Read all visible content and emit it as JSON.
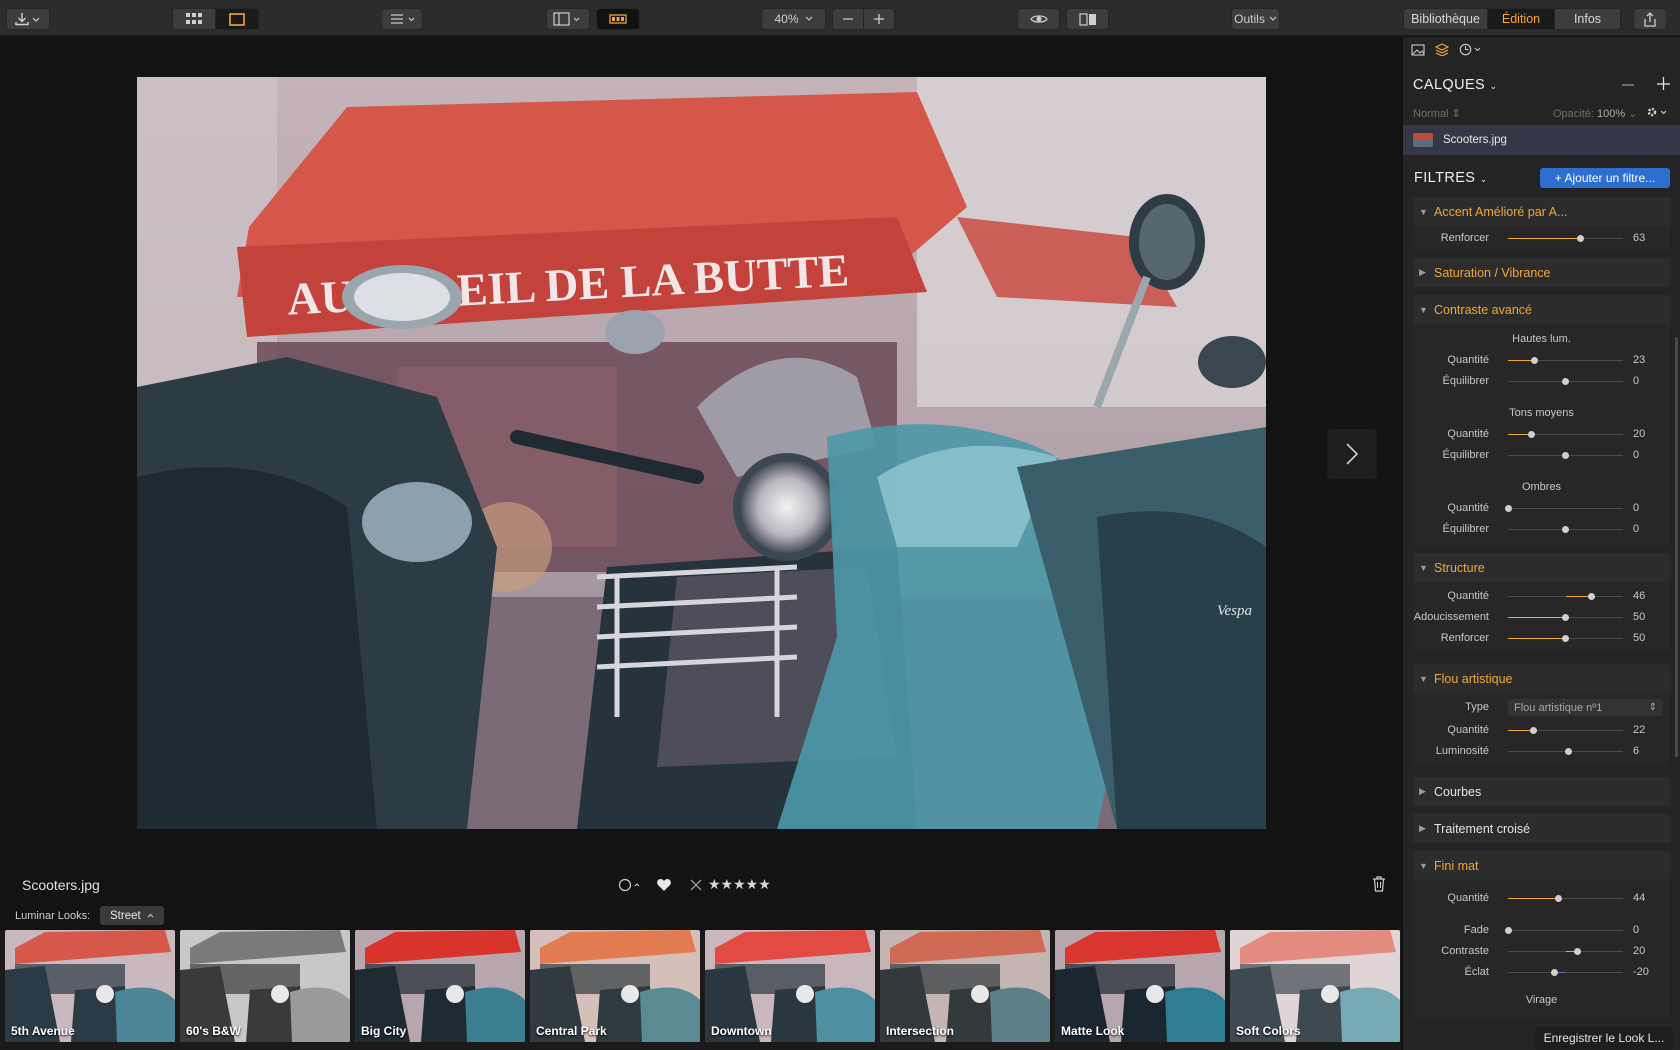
{
  "toolbar": {
    "zoom": "40%",
    "tools_label": "Outils",
    "tabs": [
      "Bibliothèque",
      "Édition",
      "Infos"
    ],
    "active_tab": "Édition",
    "accent": "#f0a83a"
  },
  "image": {
    "filename": "Scooters.jpg",
    "awning_text": "AU SOLEIL DE LA BUTTE",
    "scooter_badge": "Vespa"
  },
  "rating": {
    "stars": "★★★★★"
  },
  "looks": {
    "label": "Luminar Looks:",
    "selected": "Street",
    "items": [
      "5th Avenue",
      "60's B&W",
      "Big City",
      "Central Park",
      "Downtown",
      "Intersection",
      "Matte Look",
      "Soft Colors"
    ]
  },
  "panel": {
    "layers_title": "CALQUES",
    "blend_mode": "Normal",
    "opacity_label": "Opacité:",
    "opacity_value": "100%",
    "layer_name": "Scooters.jpg",
    "filters_title": "FILTRES",
    "add_filter": "+ Ajouter un filtre...",
    "save_look": "Enregistrer le Look L...",
    "sections": {
      "accent": {
        "title": "Accent Amélioré par A...",
        "renforcer_label": "Renforcer",
        "renforcer": 63
      },
      "saturation": {
        "title": "Saturation / Vibrance"
      },
      "contraste": {
        "title": "Contraste avancé",
        "hautes": "Hautes lum.",
        "tons": "Tons moyens",
        "ombres": "Ombres",
        "quantite_label": "Quantité",
        "equilibrer_label": "Équilibrer",
        "hautes_quantite": 23,
        "hautes_equilibrer": 0,
        "tons_quantite": 20,
        "tons_equilibrer": 0,
        "ombres_quantite": 0,
        "ombres_equilibrer": 0
      },
      "structure": {
        "title": "Structure",
        "quantite_label": "Quantité",
        "adoucissement_label": "Adoucissement",
        "renforcer_label": "Renforcer",
        "quantite": 46,
        "adoucissement": 50,
        "renforcer": 50
      },
      "flou": {
        "title": "Flou artistique",
        "type_label": "Type",
        "type_value": "Flou artistique nº1",
        "quantite_label": "Quantité",
        "luminosite_label": "Luminosité",
        "quantite": 22,
        "luminosite": 6
      },
      "courbes": {
        "title": "Courbes"
      },
      "traitement": {
        "title": "Traitement croisé"
      },
      "fini": {
        "title": "Fini mat",
        "quantite_label": "Quantité",
        "fade_label": "Fade",
        "contraste_label": "Contraste",
        "eclat_label": "Éclat",
        "quantite": 44,
        "fade": 0,
        "contraste": 20,
        "eclat": -20,
        "virage": "Virage"
      }
    }
  }
}
